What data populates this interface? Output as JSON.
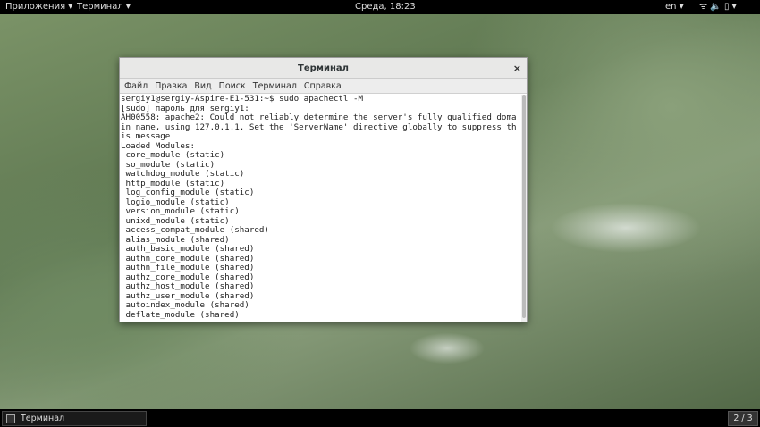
{
  "topbar": {
    "apps": "Приложения ▾",
    "terminal": "Терминал ▾",
    "clock": "Среда, 18:23",
    "lang": "en ▾",
    "status_icons": "wifi-icon volume-icon battery-icon",
    "status_glyphs": "ᯤ  🔈  ▯ ▾"
  },
  "window": {
    "title": "Терминал",
    "close": "×",
    "menu": [
      "Файл",
      "Правка",
      "Вид",
      "Поиск",
      "Терминал",
      "Справка"
    ],
    "lines": [
      "sergiy1@sergiy-Aspire-E1-531:~$ sudo apachectl -M",
      "[sudo] пароль для sergiy1:",
      "AH00558: apache2: Could not reliably determine the server's fully qualified doma",
      "in name, using 127.0.1.1. Set the 'ServerName' directive globally to suppress th",
      "is message",
      "Loaded Modules:",
      " core_module (static)",
      " so_module (static)",
      " watchdog_module (static)",
      " http_module (static)",
      " log_config_module (static)",
      " logio_module (static)",
      " version_module (static)",
      " unixd_module (static)",
      " access_compat_module (shared)",
      " alias_module (shared)",
      " auth_basic_module (shared)",
      " authn_core_module (shared)",
      " authn_file_module (shared)",
      " authz_core_module (shared)",
      " authz_host_module (shared)",
      " authz_user_module (shared)",
      " autoindex_module (shared)",
      " deflate_module (shared)"
    ]
  },
  "taskbar": {
    "task": "Терминал",
    "workspace": "2 / 3"
  }
}
